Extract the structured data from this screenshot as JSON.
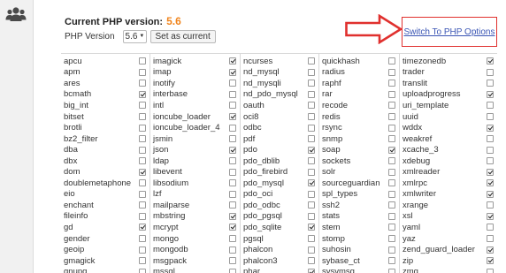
{
  "header": {
    "current_label": "Current PHP version:",
    "current_value": "5.6",
    "php_version_label": "PHP Version",
    "selected_version": "5.6",
    "set_button": "Set as current",
    "switch_link": "Switch To PHP Options"
  },
  "colors": {
    "accent_version": "#f0841c",
    "arrow_red": "#e0302e",
    "link_blue": "#3a55b4"
  },
  "icons": {
    "sidebar": "users-icon",
    "annotation": "red-arrow-icon"
  },
  "extensions": [
    [
      {
        "name": "apcu",
        "checked": false
      },
      {
        "name": "apm",
        "checked": false
      },
      {
        "name": "ares",
        "checked": false
      },
      {
        "name": "bcmath",
        "checked": true
      },
      {
        "name": "big_int",
        "checked": false
      },
      {
        "name": "bitset",
        "checked": false
      },
      {
        "name": "brotli",
        "checked": false
      },
      {
        "name": "bz2_filter",
        "checked": false
      },
      {
        "name": "dba",
        "checked": false
      },
      {
        "name": "dbx",
        "checked": false
      },
      {
        "name": "dom",
        "checked": true
      },
      {
        "name": "doublemetaphone",
        "checked": false
      },
      {
        "name": "eio",
        "checked": false
      },
      {
        "name": "enchant",
        "checked": false
      },
      {
        "name": "fileinfo",
        "checked": false
      },
      {
        "name": "gd",
        "checked": true
      },
      {
        "name": "gender",
        "checked": false
      },
      {
        "name": "geoip",
        "checked": false
      },
      {
        "name": "gmagick",
        "checked": false
      },
      {
        "name": "gnupg",
        "checked": false
      }
    ],
    [
      {
        "name": "imagick",
        "checked": true
      },
      {
        "name": "imap",
        "checked": true
      },
      {
        "name": "inotify",
        "checked": false
      },
      {
        "name": "interbase",
        "checked": false
      },
      {
        "name": "intl",
        "checked": false
      },
      {
        "name": "ioncube_loader",
        "checked": true
      },
      {
        "name": "ioncube_loader_4",
        "checked": false
      },
      {
        "name": "jsmin",
        "checked": false
      },
      {
        "name": "json",
        "checked": true
      },
      {
        "name": "ldap",
        "checked": false
      },
      {
        "name": "libevent",
        "checked": false
      },
      {
        "name": "libsodium",
        "checked": false
      },
      {
        "name": "lzf",
        "checked": false
      },
      {
        "name": "mailparse",
        "checked": false
      },
      {
        "name": "mbstring",
        "checked": true
      },
      {
        "name": "mcrypt",
        "checked": true
      },
      {
        "name": "mongo",
        "checked": false
      },
      {
        "name": "mongodb",
        "checked": false
      },
      {
        "name": "msgpack",
        "checked": false
      },
      {
        "name": "mssql",
        "checked": false
      }
    ],
    [
      {
        "name": "ncurses",
        "checked": false
      },
      {
        "name": "nd_mysql",
        "checked": false
      },
      {
        "name": "nd_mysqli",
        "checked": false
      },
      {
        "name": "nd_pdo_mysql",
        "checked": false
      },
      {
        "name": "oauth",
        "checked": false
      },
      {
        "name": "oci8",
        "checked": false
      },
      {
        "name": "odbc",
        "checked": false
      },
      {
        "name": "pdf",
        "checked": false
      },
      {
        "name": "pdo",
        "checked": true
      },
      {
        "name": "pdo_dblib",
        "checked": false
      },
      {
        "name": "pdo_firebird",
        "checked": false
      },
      {
        "name": "pdo_mysql",
        "checked": true
      },
      {
        "name": "pdo_oci",
        "checked": false
      },
      {
        "name": "pdo_odbc",
        "checked": false
      },
      {
        "name": "pdo_pgsql",
        "checked": false
      },
      {
        "name": "pdo_sqlite",
        "checked": true
      },
      {
        "name": "pgsql",
        "checked": false
      },
      {
        "name": "phalcon",
        "checked": false
      },
      {
        "name": "phalcon3",
        "checked": false
      },
      {
        "name": "phar",
        "checked": true
      }
    ],
    [
      {
        "name": "quickhash",
        "checked": false
      },
      {
        "name": "radius",
        "checked": false
      },
      {
        "name": "raphf",
        "checked": false
      },
      {
        "name": "rar",
        "checked": false
      },
      {
        "name": "recode",
        "checked": false
      },
      {
        "name": "redis",
        "checked": false
      },
      {
        "name": "rsync",
        "checked": false
      },
      {
        "name": "snmp",
        "checked": false
      },
      {
        "name": "soap",
        "checked": true
      },
      {
        "name": "sockets",
        "checked": false
      },
      {
        "name": "solr",
        "checked": false
      },
      {
        "name": "sourceguardian",
        "checked": false
      },
      {
        "name": "spl_types",
        "checked": false
      },
      {
        "name": "ssh2",
        "checked": false
      },
      {
        "name": "stats",
        "checked": false
      },
      {
        "name": "stem",
        "checked": false
      },
      {
        "name": "stomp",
        "checked": false
      },
      {
        "name": "suhosin",
        "checked": false
      },
      {
        "name": "sybase_ct",
        "checked": false
      },
      {
        "name": "sysvmsg",
        "checked": false
      }
    ],
    [
      {
        "name": "timezonedb",
        "checked": true
      },
      {
        "name": "trader",
        "checked": false
      },
      {
        "name": "translit",
        "checked": false
      },
      {
        "name": "uploadprogress",
        "checked": true
      },
      {
        "name": "uri_template",
        "checked": false
      },
      {
        "name": "uuid",
        "checked": false
      },
      {
        "name": "wddx",
        "checked": true
      },
      {
        "name": "weakref",
        "checked": false
      },
      {
        "name": "xcache_3",
        "checked": false
      },
      {
        "name": "xdebug",
        "checked": false
      },
      {
        "name": "xmlreader",
        "checked": true
      },
      {
        "name": "xmlrpc",
        "checked": true
      },
      {
        "name": "xmlwriter",
        "checked": true
      },
      {
        "name": "xrange",
        "checked": false
      },
      {
        "name": "xsl",
        "checked": true
      },
      {
        "name": "yaml",
        "checked": false
      },
      {
        "name": "yaz",
        "checked": false
      },
      {
        "name": "zend_guard_loader",
        "checked": true
      },
      {
        "name": "zip",
        "checked": true
      },
      {
        "name": "zmq",
        "checked": false
      }
    ]
  ]
}
